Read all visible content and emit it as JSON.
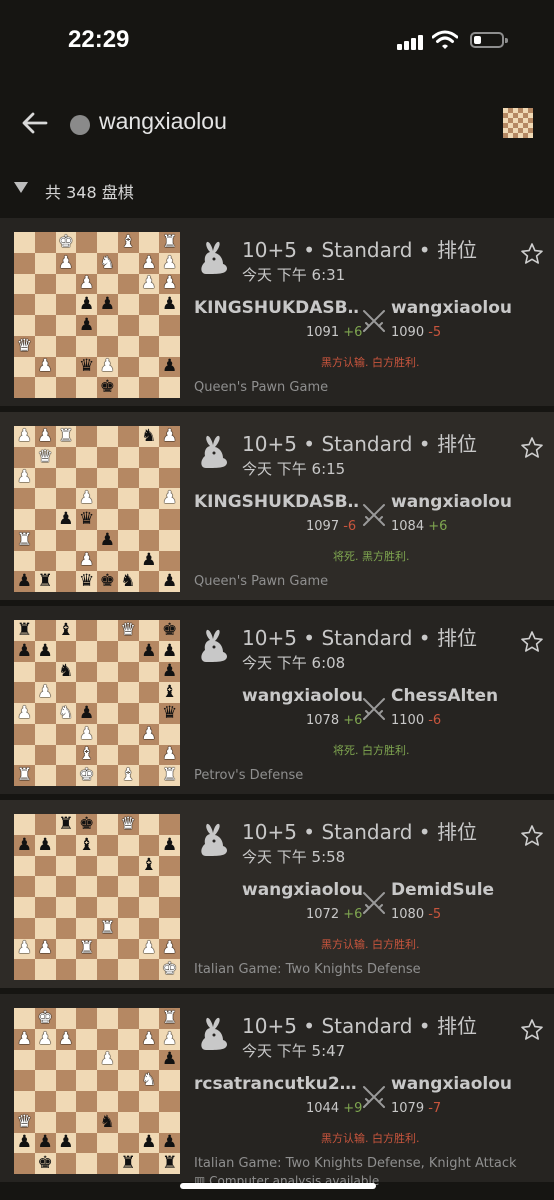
{
  "status_bar": {
    "time": "22:29"
  },
  "header": {
    "username": "wangxiaolou"
  },
  "games_count": "共 348 盘棋",
  "colors": {
    "win_green": "#7fa650",
    "loss_red": "#c8553d",
    "card_bg": "#262421",
    "board_light": "#f0d9b5",
    "board_dark": "#b58863"
  },
  "games": [
    {
      "meta": "10+5 • Standard • 排位",
      "time": "今天 下午 6:31",
      "white_name": "KINGSHUKDASB…",
      "white_rating": "1091",
      "white_diff": "+6",
      "black_name": "wangxiaolou",
      "black_rating": "1090",
      "black_diff": "-5",
      "result": "黑方认输. 白方胜利.",
      "opening": "Queen's Pawn Game",
      "board": [
        "..K..B.R",
        "..P.N.PP",
        "...P..PP",
        "...pp..p",
        "...p....",
        "Q.......",
        ".P.qP..p",
        "....k..."
      ]
    },
    {
      "meta": "10+5 • Standard • 排位",
      "time": "今天 下午 6:15",
      "white_name": "KINGSHUKDASB…",
      "white_rating": "1097",
      "white_diff": "-6",
      "black_name": "wangxiaolou",
      "black_rating": "1084",
      "black_diff": "+6",
      "result": "将死. 黑方胜利.",
      "opening": "Queen's Pawn Game",
      "board": [
        "PPR...nP",
        ".Q......",
        "P.......",
        "...P...P",
        "..pq....",
        "R...p...",
        "...P..p.",
        "pr.qkn.p"
      ]
    },
    {
      "meta": "10+5 • Standard • 排位",
      "time": "今天 下午 6:08",
      "white_name": "wangxiaolou",
      "white_rating": "1078",
      "white_diff": "+6",
      "black_name": "ChessAlten",
      "black_rating": "1100",
      "black_diff": "-6",
      "result": "将死. 白方胜利.",
      "opening": "Petrov's Defense",
      "board": [
        "r.b..Q.k",
        "pp....pp",
        "..n....p",
        ".P.....b",
        "P.Np...q",
        "...P..P.",
        "...B...P",
        "R..K.B.R"
      ]
    },
    {
      "meta": "10+5 • Standard • 排位",
      "time": "今天 下午 5:58",
      "white_name": "wangxiaolou",
      "white_rating": "1072",
      "white_diff": "+6",
      "black_name": "DemidSule",
      "black_rating": "1080",
      "black_diff": "-5",
      "result": "黑方认输. 白方胜利.",
      "opening": "Italian Game: Two Knights Defense",
      "board": [
        "..rk.Q..",
        "pp.b...p",
        "......b.",
        "........",
        "........",
        "....R...",
        "PP.R..PP",
        ".......K"
      ]
    },
    {
      "meta": "10+5 • Standard • 排位",
      "time": "今天 下午 5:47",
      "white_name": "rcsatrancutku2…",
      "white_rating": "1044",
      "white_diff": "+9",
      "black_name": "wangxiaolou",
      "black_rating": "1079",
      "black_diff": "-7",
      "result": "黑方认输. 白方胜利.",
      "opening": "Italian Game: Two Knights Defense, Knight Attack",
      "analysis": "Computer analysis available",
      "board": [
        ".K.....R",
        "PPP...PP",
        "....P..p",
        "......N.",
        "........",
        "Q...n...",
        "ppp...pp",
        ".k...r.r"
      ]
    }
  ]
}
